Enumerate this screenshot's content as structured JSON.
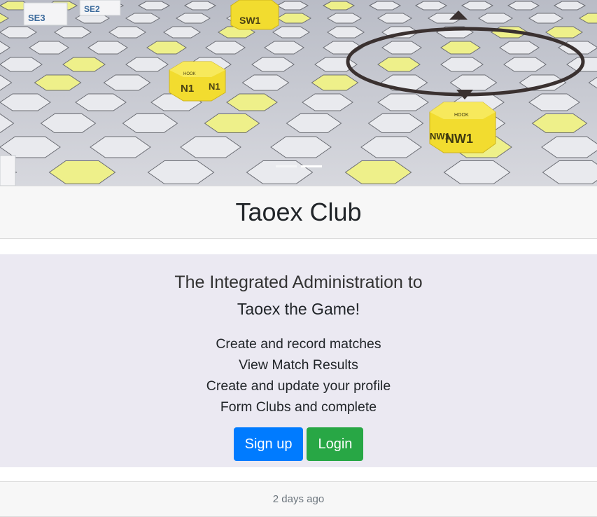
{
  "hero": {
    "piece_labels": [
      "N1",
      "N1",
      "NW1",
      "NW1",
      "SW1",
      "SE3",
      "SE2",
      "HOOK"
    ],
    "indicator_count": 2
  },
  "header": {
    "title": "Taoex Club"
  },
  "jumbotron": {
    "lead_line1": "The Integrated Administration to",
    "lead_line2": "Taoex the Game!",
    "features": [
      "Create and record matches",
      "View Match Results",
      "Create and update your profile",
      "Form Clubs and complete"
    ],
    "signup_label": "Sign up",
    "login_label": "Login"
  },
  "footer": {
    "timestamp": "2 days ago"
  },
  "colors": {
    "primary": "#007bff",
    "success": "#28a745",
    "jumbotron_bg": "#ebe9f2",
    "header_bg": "#f7f7f7",
    "piece_yellow": "#f2dc2f"
  }
}
